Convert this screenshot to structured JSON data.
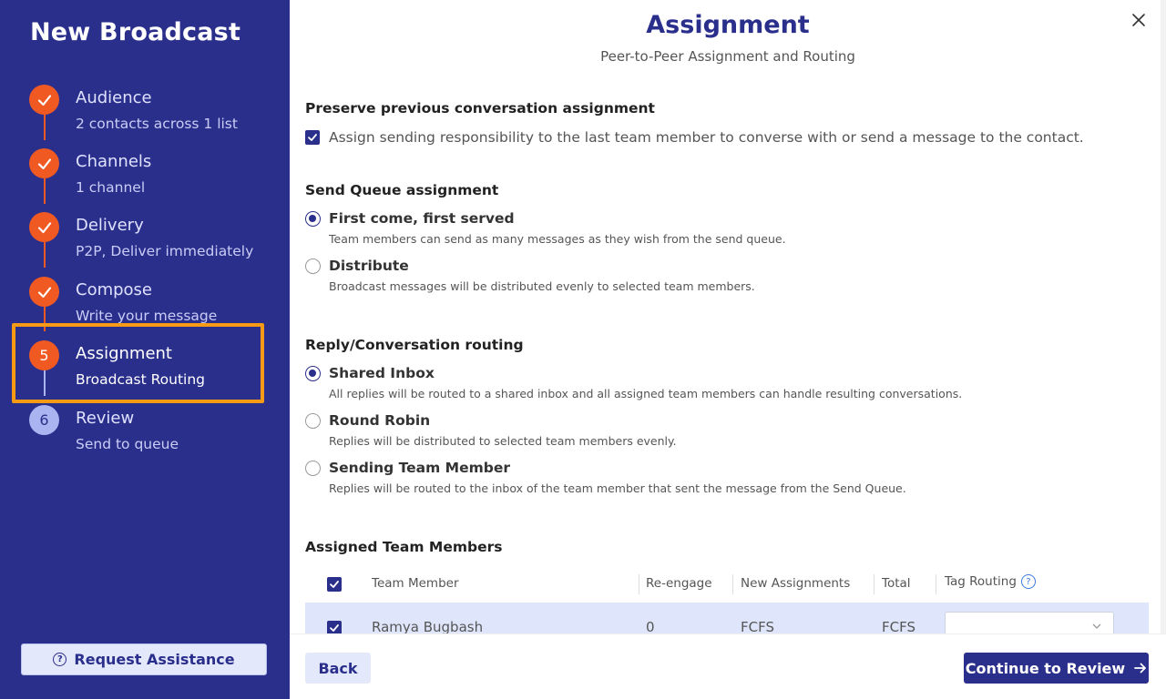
{
  "sidebar": {
    "title": "New Broadcast",
    "steps": [
      {
        "number": "1",
        "title": "Audience",
        "subtitle": "2 contacts across 1 list",
        "state": "complete"
      },
      {
        "number": "2",
        "title": "Channels",
        "subtitle": "1 channel",
        "state": "complete"
      },
      {
        "number": "3",
        "title": "Delivery",
        "subtitle": "P2P, Deliver immediately",
        "state": "complete"
      },
      {
        "number": "4",
        "title": "Compose",
        "subtitle": "Write your message",
        "state": "complete"
      },
      {
        "number": "5",
        "title": "Assignment",
        "subtitle": "Broadcast Routing",
        "state": "active"
      },
      {
        "number": "6",
        "title": "Review",
        "subtitle": "Send to queue",
        "state": "pending"
      }
    ],
    "assist_label": "Request Assistance"
  },
  "main": {
    "title": "Assignment",
    "subtitle": "Peer-to-Peer Assignment and Routing",
    "preserve": {
      "heading": "Preserve previous conversation assignment",
      "checkbox_label": "Assign sending responsibility to the last team member to converse with or send a message to the contact.",
      "checked": true
    },
    "send_queue": {
      "heading": "Send Queue assignment",
      "options": [
        {
          "label": "First come, first served",
          "desc": "Team members can send as many messages as they wish from the send queue.",
          "selected": true
        },
        {
          "label": "Distribute",
          "desc": "Broadcast messages will be distributed evenly to selected team members.",
          "selected": false
        }
      ]
    },
    "routing": {
      "heading": "Reply/Conversation routing",
      "options": [
        {
          "label": "Shared Inbox",
          "desc": "All replies will be routed to a shared inbox and all assigned team members can handle resulting conversations.",
          "selected": true
        },
        {
          "label": "Round Robin",
          "desc": "Replies will be distributed to selected team members evenly.",
          "selected": false
        },
        {
          "label": "Sending Team Member",
          "desc": "Replies will be routed to the inbox of the team member that sent the message from the Send Queue.",
          "selected": false
        }
      ]
    },
    "team": {
      "heading": "Assigned Team Members",
      "columns": [
        "Team Member",
        "Re-engage",
        "New Assignments",
        "Total",
        "Tag Routing"
      ],
      "rows": [
        {
          "name": "Ramya Bugbash",
          "reengage": "0",
          "new_assignments": "FCFS",
          "total": "FCFS",
          "tag_routing": ""
        }
      ]
    }
  },
  "footer": {
    "back_label": "Back",
    "continue_label": "Continue to Review"
  },
  "colors": {
    "sidebar_bg": "#2b2f8c",
    "accent_orange": "#f05a22",
    "highlight": "#f79a16"
  }
}
